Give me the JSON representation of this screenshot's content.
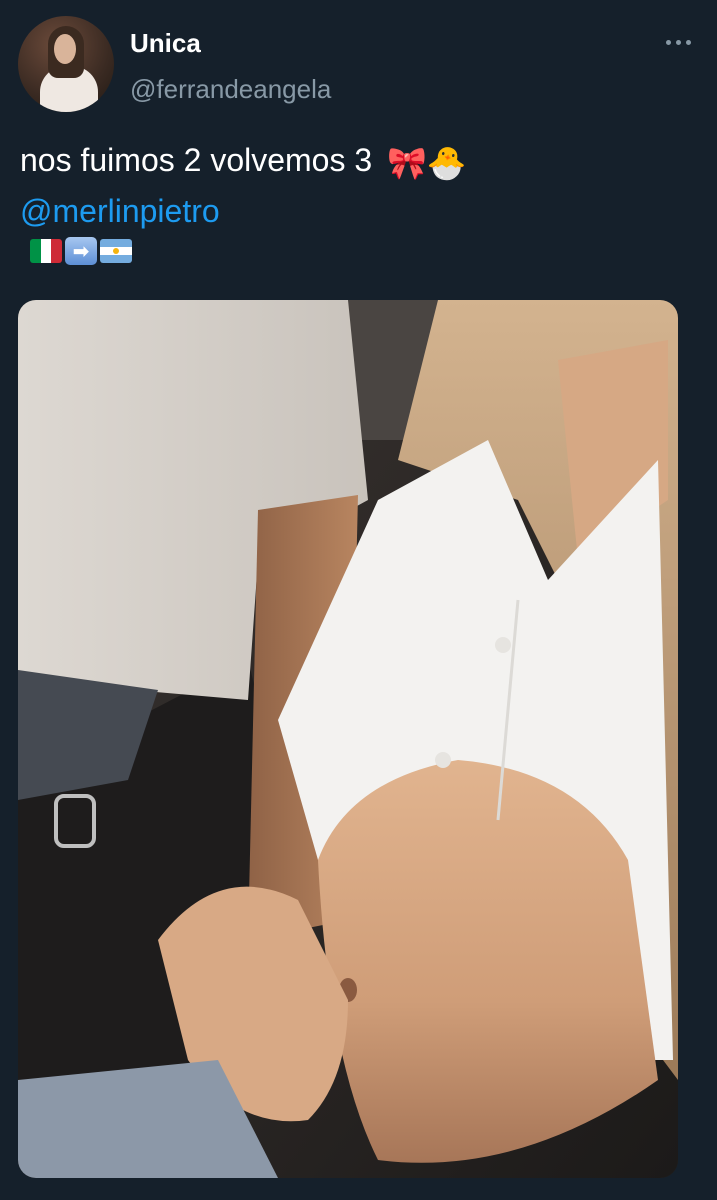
{
  "tweet": {
    "display_name": "Unica",
    "handle": "@ferrandeangela",
    "text_line1": "nos fuimos 2 volvemos 3",
    "text_emojis": "🎀🐣",
    "mention": "@merlinpietro",
    "flag_arrow": "➡"
  },
  "icons": {
    "more": "more-horizontal-icon",
    "flag_from": "italy-flag-icon",
    "flag_to": "argentina-flag-icon"
  },
  "colors": {
    "background": "#15202b",
    "text": "#ffffff",
    "secondary_text": "#8899a6",
    "mention": "#1d9bf0"
  }
}
